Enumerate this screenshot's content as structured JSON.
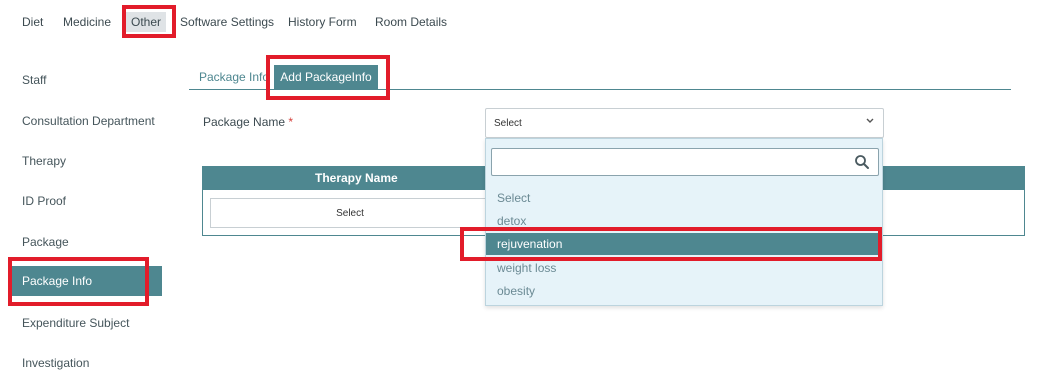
{
  "topnav": {
    "items": [
      {
        "label": "Diet"
      },
      {
        "label": "Medicine"
      },
      {
        "label": "Other"
      },
      {
        "label": "Software Settings"
      },
      {
        "label": "History Form"
      },
      {
        "label": "Room Details"
      }
    ]
  },
  "sidebar": {
    "items": [
      {
        "label": "Staff"
      },
      {
        "label": "Consultation Department"
      },
      {
        "label": "Therapy"
      },
      {
        "label": "ID Proof"
      },
      {
        "label": "Package"
      },
      {
        "label": "Package Info"
      },
      {
        "label": "Expenditure Subject"
      },
      {
        "label": "Investigation"
      }
    ]
  },
  "tabs": [
    {
      "label": "Package Info"
    },
    {
      "label": "Add PackageInfo"
    }
  ],
  "form": {
    "package_name_label": "Package Name",
    "required_mark": "*",
    "package_select_value": "Select"
  },
  "table": {
    "header": "Therapy Name",
    "row_select_value": "Select"
  },
  "dropdown": {
    "search_value": "",
    "options": [
      {
        "label": "Select"
      },
      {
        "label": "detox"
      },
      {
        "label": "rejuvenation"
      },
      {
        "label": "weight loss"
      },
      {
        "label": "obesity"
      }
    ],
    "highlighted": "rejuvenation"
  },
  "colors": {
    "accent": "#4e8790",
    "highlight_box": "#e21c2a",
    "dropdown_bg": "#e6f3f9"
  }
}
